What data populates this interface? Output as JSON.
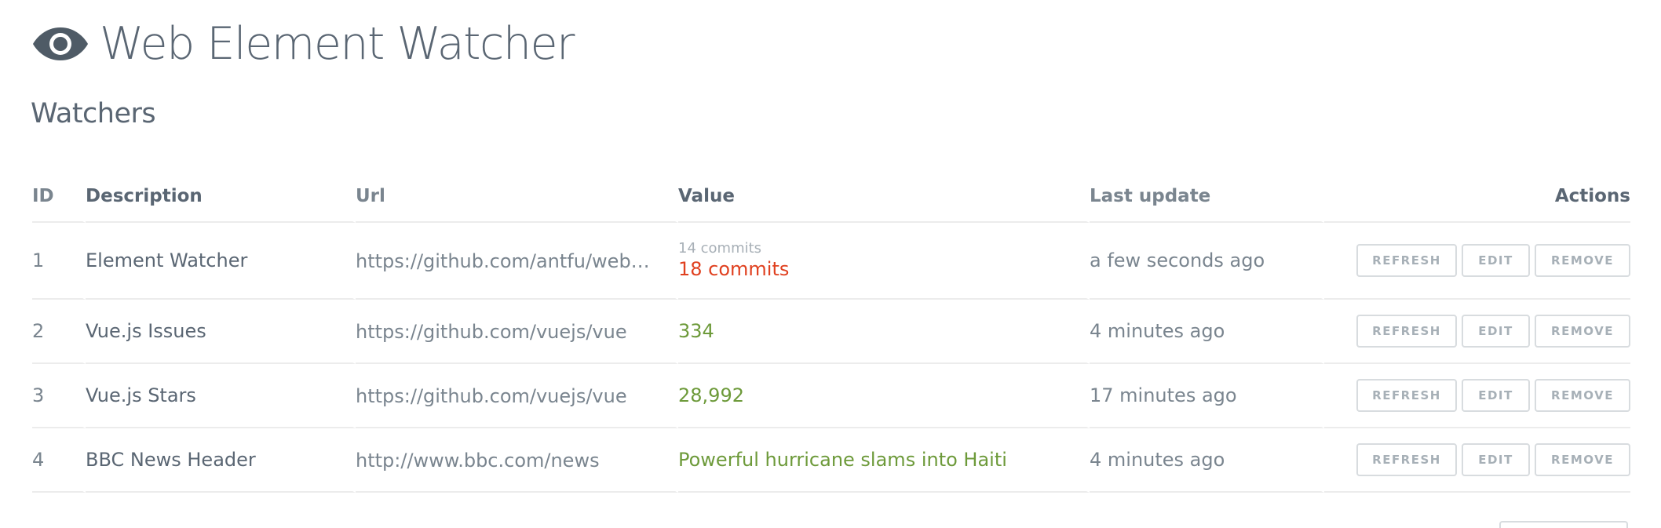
{
  "app": {
    "title": "Web Element Watcher",
    "icon": "eye-icon"
  },
  "section": {
    "title": "Watchers"
  },
  "table": {
    "headers": {
      "id": "ID",
      "description": "Description",
      "url": "Url",
      "value": "Value",
      "last_update": "Last update",
      "actions": "Actions"
    },
    "rows": [
      {
        "id": "1",
        "description": "Element Watcher",
        "url": "https://github.com/antfu/web-element-watcher",
        "old_value": "14 commits",
        "value": "18 commits",
        "changed": true,
        "last_update": "a few seconds ago"
      },
      {
        "id": "2",
        "description": "Vue.js Issues",
        "url": "https://github.com/vuejs/vue",
        "value": "334",
        "changed": false,
        "last_update": "4 minutes ago"
      },
      {
        "id": "3",
        "description": "Vue.js Stars",
        "url": "https://github.com/vuejs/vue",
        "value": "28,992",
        "changed": false,
        "last_update": "17 minutes ago"
      },
      {
        "id": "4",
        "description": "BBC News Header",
        "url": "http://www.bbc.com/news",
        "value": "Powerful hurricane slams into Haiti",
        "changed": false,
        "last_update": "4 minutes ago"
      }
    ]
  },
  "actions": {
    "refresh_label": "REFRESH",
    "edit_label": "EDIT",
    "remove_label": "REMOVE"
  },
  "colors": {
    "text": "#5a6673",
    "muted": "#7a858f",
    "changed": "#e0401f",
    "value_ok": "#6d9a3a",
    "button_border": "#d8dcdf",
    "button_text": "#a7b0b7"
  }
}
